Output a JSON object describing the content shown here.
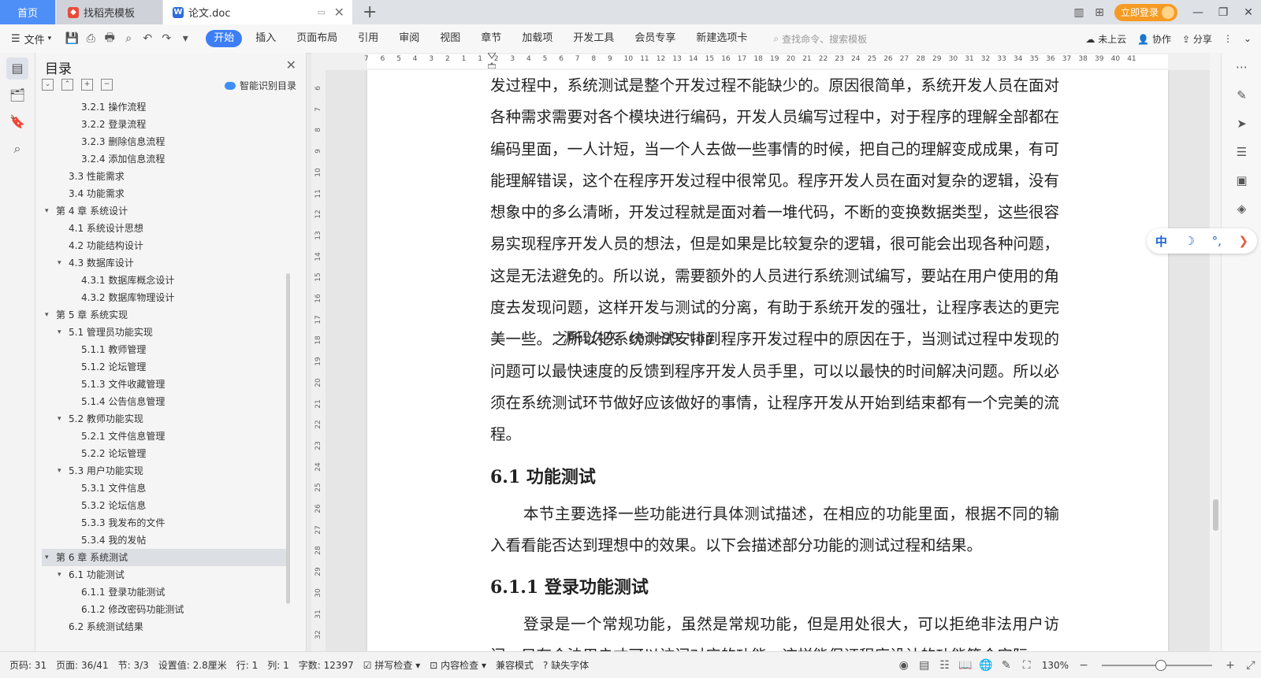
{
  "tabs": {
    "home": "首页",
    "template": "找稻壳模板",
    "doc": "论文.doc",
    "new_tab": "+"
  },
  "titlebar": {
    "login_label": "立即登录"
  },
  "menu": {
    "file": "文件",
    "tabs": [
      "开始",
      "插入",
      "页面布局",
      "引用",
      "审阅",
      "视图",
      "章节",
      "加载项",
      "开发工具",
      "会员专享",
      "新建选项卡"
    ],
    "active_tab": "开始",
    "search_placeholder": "查找命令、搜索模板",
    "cloud": "未上云",
    "collab": "协作",
    "share": "分享"
  },
  "toc": {
    "title": "目录",
    "smart_label": "智能识别目录",
    "items": [
      {
        "label": "3.2.1  操作流程",
        "level": 3
      },
      {
        "label": "3.2.2  登录流程",
        "level": 3
      },
      {
        "label": "3.2.3  删除信息流程",
        "level": 3
      },
      {
        "label": "3.2.4  添加信息流程",
        "level": 3
      },
      {
        "label": "3.3  性能需求",
        "level": 2
      },
      {
        "label": "3.4  功能需求",
        "level": 2
      },
      {
        "label": "第 4 章  系统设计",
        "level": 1,
        "expanded": true
      },
      {
        "label": "4.1  系统设计思想",
        "level": 2
      },
      {
        "label": "4.2  功能结构设计",
        "level": 2
      },
      {
        "label": "4.3  数据库设计",
        "level": 2,
        "expanded": true
      },
      {
        "label": "4.3.1  数据库概念设计",
        "level": 3
      },
      {
        "label": "4.3.2  数据库物理设计",
        "level": 3
      },
      {
        "label": "第 5 章  系统实现",
        "level": 1,
        "expanded": true
      },
      {
        "label": "5.1  管理员功能实现",
        "level": 2,
        "expanded": true
      },
      {
        "label": "5.1.1  教师管理",
        "level": 3
      },
      {
        "label": "5.1.2  论坛管理",
        "level": 3
      },
      {
        "label": "5.1.3  文件收藏管理",
        "level": 3
      },
      {
        "label": "5.1.4  公告信息管理",
        "level": 3
      },
      {
        "label": "5.2  教师功能实现",
        "level": 2,
        "expanded": true
      },
      {
        "label": "5.2.1  文件信息管理",
        "level": 3
      },
      {
        "label": "5.2.2  论坛管理",
        "level": 3
      },
      {
        "label": "5.3  用户功能实现",
        "level": 2,
        "expanded": true
      },
      {
        "label": "5.3.1  文件信息",
        "level": 3
      },
      {
        "label": "5.3.2  论坛信息",
        "level": 3
      },
      {
        "label": "5.3.3  我发布的文件",
        "level": 3
      },
      {
        "label": "5.3.4  我的发帖",
        "level": 3
      },
      {
        "label": "第 6 章  系统测试",
        "level": 1,
        "expanded": true,
        "selected": true
      },
      {
        "label": "6.1  功能测试",
        "level": 2,
        "expanded": true
      },
      {
        "label": "6.1.1  登录功能测试",
        "level": 3
      },
      {
        "label": "6.1.2  修改密码功能测试",
        "level": 3
      },
      {
        "label": "6.2  系统测试结果",
        "level": 2
      }
    ]
  },
  "ruler": {
    "horizontal": [
      "7",
      "6",
      "5",
      "4",
      "3",
      "2",
      "1",
      "1",
      "2",
      "3",
      "4",
      "5",
      "6",
      "7",
      "8",
      "9",
      "10",
      "11",
      "12",
      "13",
      "14",
      "15",
      "16",
      "17",
      "18",
      "19",
      "20",
      "21",
      "22",
      "23",
      "24",
      "25",
      "26",
      "27",
      "28",
      "29",
      "30",
      "31",
      "32",
      "33",
      "34",
      "35",
      "36",
      "37",
      "38",
      "39",
      "40",
      "41"
    ],
    "vertical": [
      "6",
      "7",
      "8",
      "9",
      "10",
      "11",
      "12",
      "13",
      "14",
      "15",
      "16",
      "17",
      "18",
      "19",
      "20",
      "21",
      "22",
      "23",
      "24",
      "25",
      "26",
      "27",
      "28",
      "29",
      "30",
      "31",
      "32"
    ]
  },
  "document": {
    "para1": "发过程中，系统测试是整个开发过程不能缺少的。原因很简单，系统开发人员在面对各种需求需要对各个模块进行编码，开发人员编写过程中，对于程序的理解全部都在编码里面，一人计短，当一个人去做一些事情的时候，把自己的理解变成成果，有可能理解错误，这个在程序开发过程中很常见。程序开发人员在面对复杂的逻辑，没有想象中的多么清晰，开发过程就是面对着一堆代码，不断的变换数据类型，这些很容易实现程序开发人员的想法，但是如果是比较复杂的逻辑，很可能会出现各种问题，这是无法避免的。所以说，需要额外的人员进行系统测试编写，要站在用户使用的角度去发现问题，这样开发与测试的分离，有助于系统开发的强壮，让程序表达的更完美一些。之所以把系统测试安排到程序开发过程中的原因在于，当测试过程中发现的问题可以最快速度的反馈到程序开发人员手里，可以以最快的时间解决问题。所以必须在系统测试环节做好应该做好的事情，让程序开发从开始到结束都有一个完美的流程。",
    "h_61": "6.1  功能测试",
    "para2": "本节主要选择一些功能进行具体测试描述，在相应的功能里面，根据不同的输入看看能否达到理想中的效果。以下会描述部分功能的测试过程和结果。",
    "h_611": "6.1.1  登录功能测试",
    "para3": "登录是一个常规功能，虽然是常规功能，但是用处很大，可以拒绝非法用户访问，只有合法用户才可以访问对应的功能，这样能保证程序设计的功能符合实际。",
    "watermark": "源码久久-code99.top"
  },
  "ime": {
    "lang": "中"
  },
  "status": {
    "page_code": "页码: 31",
    "page": "页面: 36/41",
    "section": "节: 3/3",
    "setting": "设置值: 2.8厘米",
    "row": "行: 1",
    "col": "列: 1",
    "words": "字数: 12397",
    "spell": "拼写检查",
    "content_check": "内容检查",
    "compat": "兼容模式",
    "missing_font": "缺失字体",
    "zoom": "130%"
  }
}
